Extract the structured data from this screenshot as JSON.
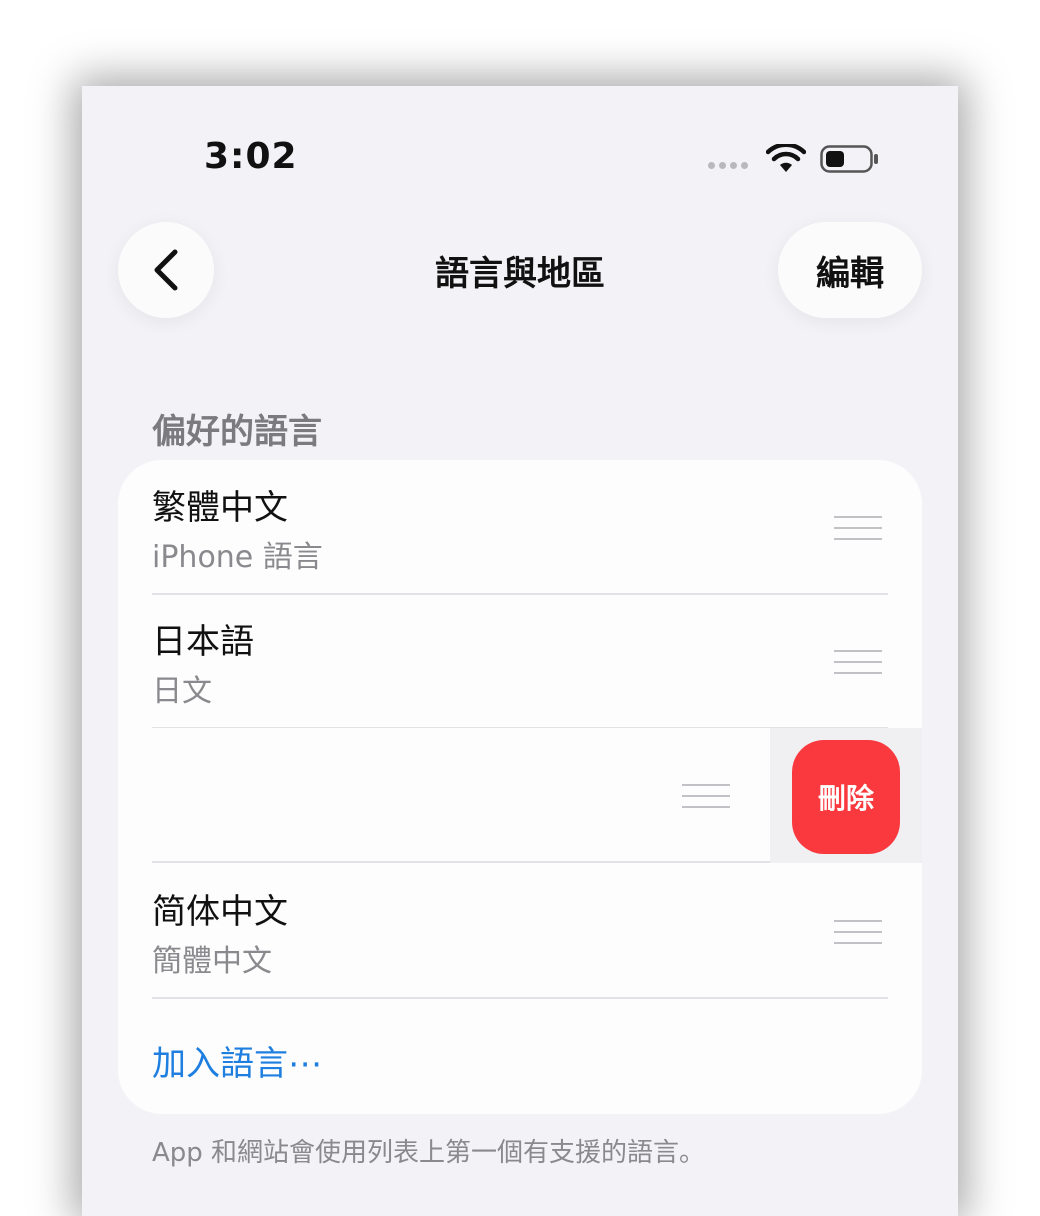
{
  "status_bar": {
    "time": "3:02",
    "icons": [
      "signal-dots-icon",
      "wifi-icon",
      "battery-icon"
    ]
  },
  "nav": {
    "title": "語言與地區",
    "back_icon": "chevron-left-icon",
    "edit_label": "編輯"
  },
  "section": {
    "header": "偏好的語言",
    "languages": [
      {
        "title": "繁體中文",
        "subtitle": "iPhone 語言"
      },
      {
        "title": "日本語",
        "subtitle": "日文"
      },
      {
        "title": "",
        "subtitle": "",
        "swiped": true
      },
      {
        "title": "简体中文",
        "subtitle": "簡體中文"
      }
    ],
    "delete_label": "刪除",
    "add_label": "加入語言⋯",
    "footer": "App 和網站會使用列表上第一個有支援的語言。"
  },
  "colors": {
    "background": "#f2f2f7",
    "card": "#fdfdfd",
    "accent": "#1e7fe0",
    "destructive": "#f9393e",
    "secondary_text": "#8a8a8e"
  }
}
